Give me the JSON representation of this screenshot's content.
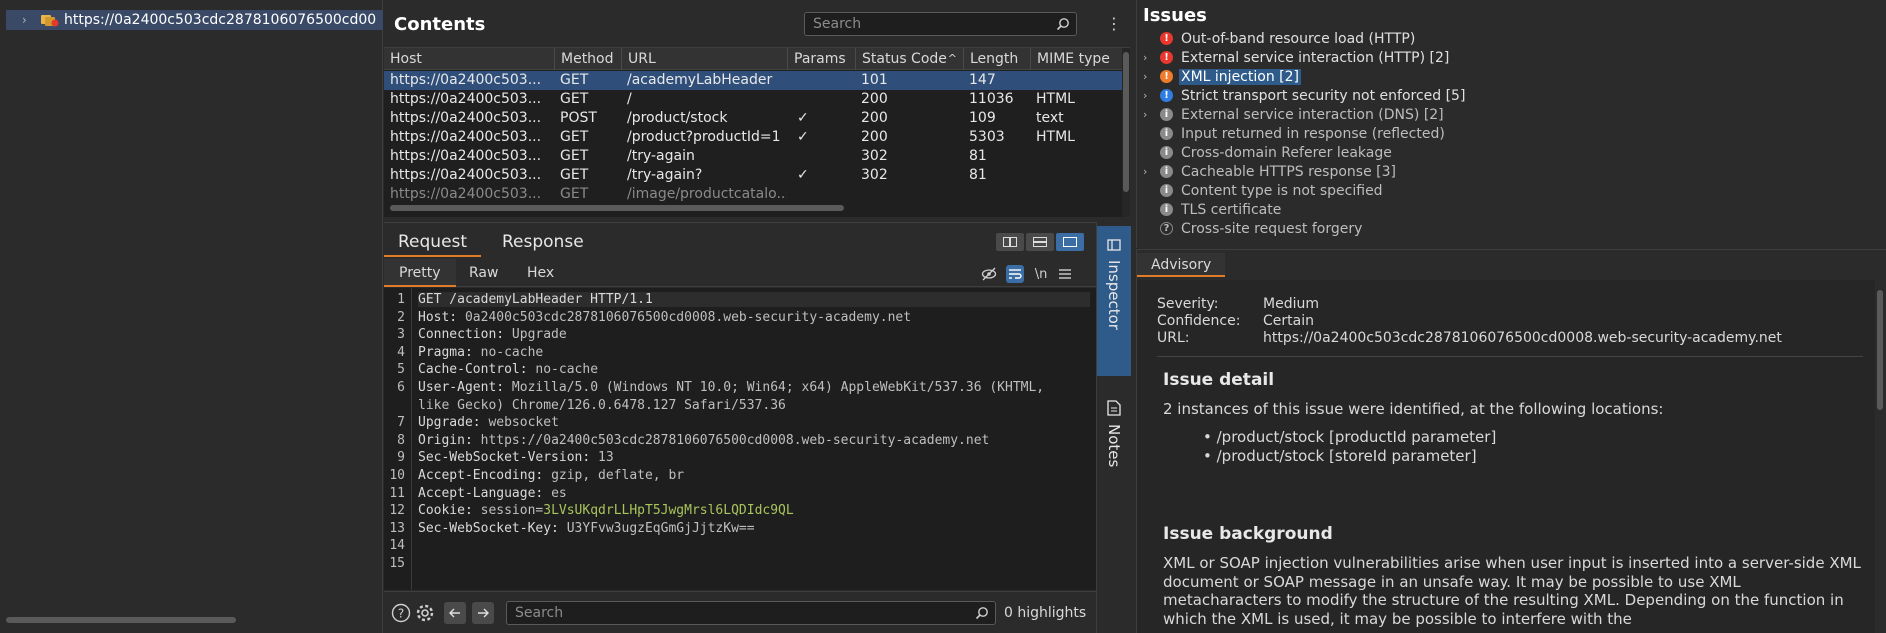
{
  "sitemap": {
    "expand_icon": "chevron-right-icon",
    "site_icon": "site-folder-icon",
    "host_label": "https://0a2400c503cdc2878106076500cd00"
  },
  "contents": {
    "title": "Contents",
    "search_placeholder": "Search",
    "more_icon": "vertical-ellipsis-icon",
    "columns": [
      "Host",
      "Method",
      "URL",
      "Params",
      "Status Code",
      "Length",
      "MIME type"
    ],
    "sort_indicator": "^",
    "rows": [
      {
        "host": "https://0a2400c503...",
        "method": "GET",
        "url": "/academyLabHeader",
        "params": "",
        "status": "101",
        "length": "147",
        "mime": ""
      },
      {
        "host": "https://0a2400c503...",
        "method": "GET",
        "url": "/",
        "params": "",
        "status": "200",
        "length": "11036",
        "mime": "HTML"
      },
      {
        "host": "https://0a2400c503...",
        "method": "POST",
        "url": "/product/stock",
        "params": "✓",
        "status": "200",
        "length": "109",
        "mime": "text"
      },
      {
        "host": "https://0a2400c503...",
        "method": "GET",
        "url": "/product?productId=1",
        "params": "✓",
        "status": "200",
        "length": "5303",
        "mime": "HTML"
      },
      {
        "host": "https://0a2400c503...",
        "method": "GET",
        "url": "/try-again",
        "params": "",
        "status": "302",
        "length": "81",
        "mime": ""
      },
      {
        "host": "https://0a2400c503...",
        "method": "GET",
        "url": "/try-again?",
        "params": "✓",
        "status": "302",
        "length": "81",
        "mime": ""
      },
      {
        "host": "https://0a2400c503...",
        "method": "GET",
        "url": "/image/productcatalo...",
        "params": "",
        "status": "",
        "length": "",
        "mime": ""
      }
    ]
  },
  "request": {
    "tabs": [
      "Request",
      "Response"
    ],
    "subtabs": [
      "Pretty",
      "Raw",
      "Hex"
    ],
    "newline_toggle": "\\n",
    "lines": [
      {
        "n": "1",
        "key": "GET /academyLabHeader HTTP/1.1",
        "val": "",
        "cookie": ""
      },
      {
        "n": "2",
        "key": "Host: ",
        "val": "0a2400c503cdc2878106076500cd0008.web-security-academy.net",
        "cookie": ""
      },
      {
        "n": "3",
        "key": "Connection: ",
        "val": "Upgrade",
        "cookie": ""
      },
      {
        "n": "4",
        "key": "Pragma: ",
        "val": "no-cache",
        "cookie": ""
      },
      {
        "n": "5",
        "key": "Cache-Control: ",
        "val": "no-cache",
        "cookie": ""
      },
      {
        "n": "6",
        "key": "User-Agent: ",
        "val": "Mozilla/5.0 (Windows NT 10.0; Win64; x64) AppleWebKit/537.36 (KHTML,",
        "cookie": ""
      },
      {
        "n": "",
        "key": "",
        "val": "like Gecko) Chrome/126.0.6478.127 Safari/537.36",
        "cookie": ""
      },
      {
        "n": "7",
        "key": "Upgrade: ",
        "val": "websocket",
        "cookie": ""
      },
      {
        "n": "8",
        "key": "Origin: ",
        "val": "https://0a2400c503cdc2878106076500cd0008.web-security-academy.net",
        "cookie": ""
      },
      {
        "n": "9",
        "key": "Sec-WebSocket-Version: ",
        "val": "13",
        "cookie": ""
      },
      {
        "n": "10",
        "key": "Accept-Encoding: ",
        "val": "gzip, deflate, br",
        "cookie": ""
      },
      {
        "n": "11",
        "key": "Accept-Language: ",
        "val": "es",
        "cookie": ""
      },
      {
        "n": "12",
        "key": "Cookie: ",
        "val": "session=",
        "cookie": "3LVsUKqdrLLHpT5JwgMrsl6LQDIdc9QL"
      },
      {
        "n": "13",
        "key": "Sec-WebSocket-Key: ",
        "val": "U3YFvw3ugzEqGmGjJjtzKw==",
        "cookie": ""
      },
      {
        "n": "14",
        "key": "",
        "val": "",
        "cookie": ""
      },
      {
        "n": "15",
        "key": "",
        "val": "",
        "cookie": ""
      }
    ],
    "search_placeholder": "Search",
    "highlights": "0 highlights"
  },
  "side_tabs": {
    "inspector": "Inspector",
    "notes": "Notes"
  },
  "issues": {
    "title": "Issues",
    "items": [
      {
        "text": "Out-of-band resource load (HTTP)",
        "severity": "high",
        "expandable": false
      },
      {
        "text": "External service interaction (HTTP) [2]",
        "severity": "high",
        "expandable": true
      },
      {
        "text": "XML injection [2]",
        "severity": "medium",
        "expandable": true
      },
      {
        "text": "Strict transport security not enforced [5]",
        "severity": "low",
        "expandable": true
      },
      {
        "text": "External service interaction (DNS) [2]",
        "severity": "info",
        "expandable": true
      },
      {
        "text": "Input returned in response (reflected)",
        "severity": "info",
        "expandable": false
      },
      {
        "text": "Cross-domain Referer leakage",
        "severity": "info",
        "expandable": false
      },
      {
        "text": "Cacheable HTTPS response [3]",
        "severity": "info",
        "expandable": true
      },
      {
        "text": "Content type is not specified",
        "severity": "info",
        "expandable": false
      },
      {
        "text": "TLS certificate",
        "severity": "info",
        "expandable": false
      },
      {
        "text": "Cross-site request forgery",
        "severity": "question",
        "expandable": false
      }
    ],
    "colors": {
      "high": "#e8372c",
      "medium": "#f07b2a",
      "low": "#2f7de1",
      "info": "#8a8a8a",
      "question": "#8a8a8a"
    }
  },
  "advisory": {
    "tab": "Advisory",
    "severity_label": "Severity:",
    "severity_value": "Medium",
    "confidence_label": "Confidence:",
    "confidence_value": "Certain",
    "url_label": "URL:",
    "url_value": "https://0a2400c503cdc2878106076500cd0008.web-security-academy.net",
    "detail_heading": "Issue detail",
    "detail_text": "2 instances of this issue were identified, at the following locations:",
    "locations": [
      "/product/stock [productId parameter]",
      "/product/stock [storeId parameter]"
    ],
    "background_heading": "Issue background",
    "background_text": "XML or SOAP injection vulnerabilities arise when user input is inserted into a server-side XML document or SOAP message in an unsafe way. It may be possible to use XML metacharacters to modify the structure of the resulting XML. Depending on the function in which the XML is used, it may be possible to interfere with the"
  }
}
